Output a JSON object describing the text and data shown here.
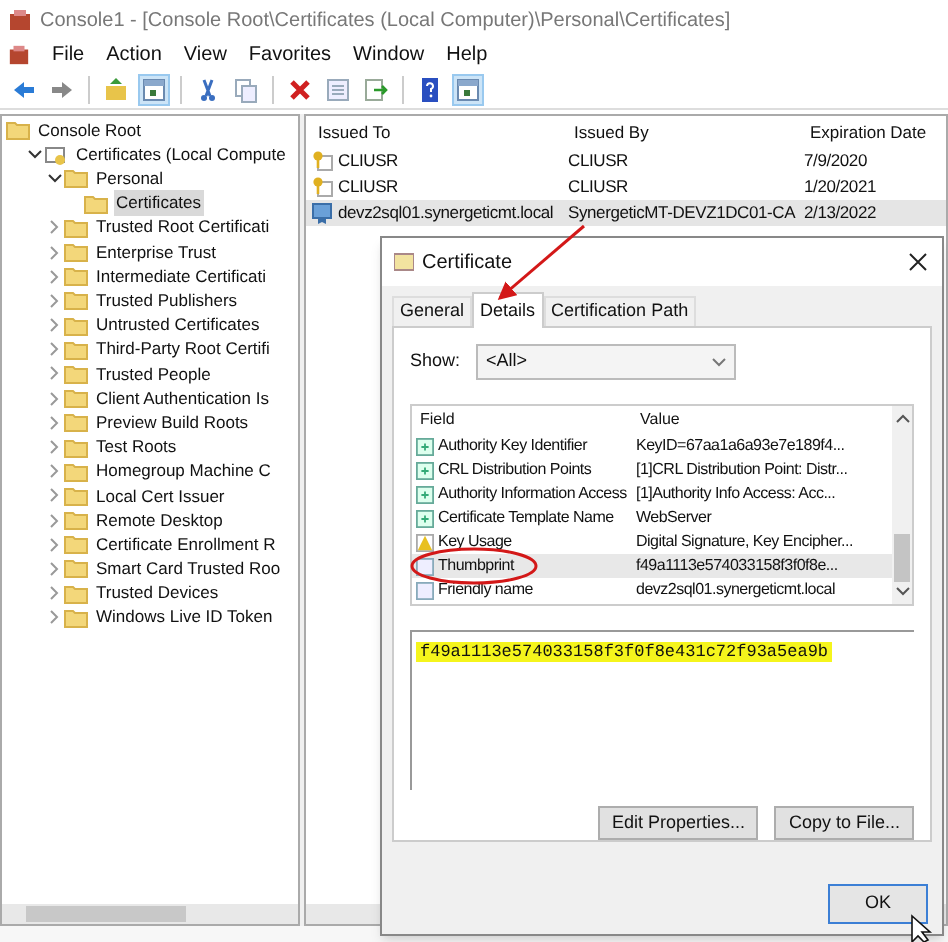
{
  "window": {
    "title": "Console1 - [Console Root\\Certificates (Local Computer)\\Personal\\Certificates]"
  },
  "menu": [
    "File",
    "Action",
    "View",
    "Favorites",
    "Window",
    "Help"
  ],
  "toolbar": [
    {
      "kind": "back",
      "pressed": false
    },
    {
      "kind": "forward",
      "pressed": false
    },
    {
      "kind": "sep"
    },
    {
      "kind": "up",
      "pressed": false
    },
    {
      "kind": "tree",
      "pressed": true
    },
    {
      "kind": "sep"
    },
    {
      "kind": "cut",
      "pressed": false
    },
    {
      "kind": "copy",
      "pressed": false
    },
    {
      "kind": "sep"
    },
    {
      "kind": "delete",
      "pressed": false
    },
    {
      "kind": "properties",
      "pressed": false
    },
    {
      "kind": "export",
      "pressed": false
    },
    {
      "kind": "sep"
    },
    {
      "kind": "help",
      "pressed": false
    },
    {
      "kind": "tree",
      "pressed": true
    }
  ],
  "tree": [
    {
      "label": "Console Root",
      "kind": "root",
      "selected": false,
      "children": [
        {
          "label": "Certificates (Local Compute",
          "kind": "store",
          "expanded": true,
          "selected": false,
          "children": [
            {
              "label": "Personal",
              "kind": "folder",
              "expanded": true,
              "selected": false,
              "children": [
                {
                  "label": "Certificates",
                  "kind": "folder",
                  "selected": true
                }
              ]
            },
            {
              "label": "Trusted Root Certificati",
              "kind": "folder",
              "expanded": false,
              "selected": false
            },
            {
              "label": "Enterprise Trust",
              "kind": "folder",
              "expanded": false,
              "selected": false
            },
            {
              "label": "Intermediate Certificati",
              "kind": "folder",
              "expanded": false,
              "selected": false
            },
            {
              "label": "Trusted Publishers",
              "kind": "folder",
              "expanded": false,
              "selected": false
            },
            {
              "label": "Untrusted Certificates",
              "kind": "folder",
              "expanded": false,
              "selected": false
            },
            {
              "label": "Third-Party Root Certifi",
              "kind": "folder",
              "expanded": false,
              "selected": false
            },
            {
              "label": "Trusted People",
              "kind": "folder",
              "expanded": false,
              "selected": false
            },
            {
              "label": "Client Authentication Is",
              "kind": "folder",
              "expanded": false,
              "selected": false
            },
            {
              "label": "Preview Build Roots",
              "kind": "folder",
              "expanded": false,
              "selected": false
            },
            {
              "label": "Test Roots",
              "kind": "folder",
              "expanded": false,
              "selected": false
            },
            {
              "label": "Homegroup Machine C",
              "kind": "folder",
              "expanded": false,
              "selected": false
            },
            {
              "label": "Local Cert Issuer",
              "kind": "folder",
              "expanded": false,
              "selected": false
            },
            {
              "label": "Remote Desktop",
              "kind": "folder",
              "expanded": false,
              "selected": false
            },
            {
              "label": "Certificate Enrollment R",
              "kind": "folder",
              "expanded": false,
              "selected": false
            },
            {
              "label": "Smart Card Trusted Roo",
              "kind": "folder",
              "expanded": false,
              "selected": false
            },
            {
              "label": "Trusted Devices",
              "kind": "folder",
              "expanded": false,
              "selected": false
            },
            {
              "label": "Windows Live ID Token",
              "kind": "folder",
              "expanded": false,
              "selected": false
            }
          ]
        }
      ]
    }
  ],
  "list": {
    "columns": [
      "Issued To",
      "Issued By",
      "Expiration Date"
    ],
    "rows": [
      {
        "cells": [
          "CLIUSR",
          "CLIUSR",
          "7/9/2020"
        ],
        "kind": "key",
        "selected": false
      },
      {
        "cells": [
          "CLIUSR",
          "CLIUSR",
          "1/20/2021"
        ],
        "kind": "key",
        "selected": false
      },
      {
        "cells": [
          "devz2sql01.synergeticmt.local",
          "SynergeticMT-DEVZ1DC01-CA",
          "2/13/2022"
        ],
        "kind": "cert",
        "selected": true
      }
    ]
  },
  "dialog": {
    "title": "Certificate",
    "tabs": [
      {
        "label": "General",
        "selected": false
      },
      {
        "label": "Details",
        "selected": true
      },
      {
        "label": "Certification Path",
        "selected": false
      }
    ],
    "show": {
      "label": "Show:",
      "value": "<All>"
    },
    "columns": [
      "Field",
      "Value"
    ],
    "fields": [
      {
        "field": "Authority Key Identifier",
        "value": "KeyID=67aa1a6a93e7e189f4...",
        "kind": "ext",
        "selected": false
      },
      {
        "field": "CRL Distribution Points",
        "value": "[1]CRL Distribution Point: Distr...",
        "kind": "ext",
        "selected": false
      },
      {
        "field": "Authority Information Access",
        "value": "[1]Authority Info Access: Acc...",
        "kind": "ext",
        "selected": false
      },
      {
        "field": "Certificate Template Name",
        "value": "WebServer",
        "kind": "ext",
        "selected": false
      },
      {
        "field": "Key Usage",
        "value": "Digital Signature, Key Encipher...",
        "kind": "critical",
        "selected": false
      },
      {
        "field": "Thumbprint",
        "value": "f49a1113e574033158f3f0f8e...",
        "kind": "prop",
        "selected": true
      },
      {
        "field": "Friendly name",
        "value": "devz2sql01.synergeticmt.local",
        "kind": "prop",
        "selected": false
      }
    ],
    "detail": "f49a1113e574033158f3f0f8e431c72f93a5ea9b",
    "buttons": [
      "Edit Properties...",
      "Copy to File..."
    ],
    "ok": "OK"
  }
}
